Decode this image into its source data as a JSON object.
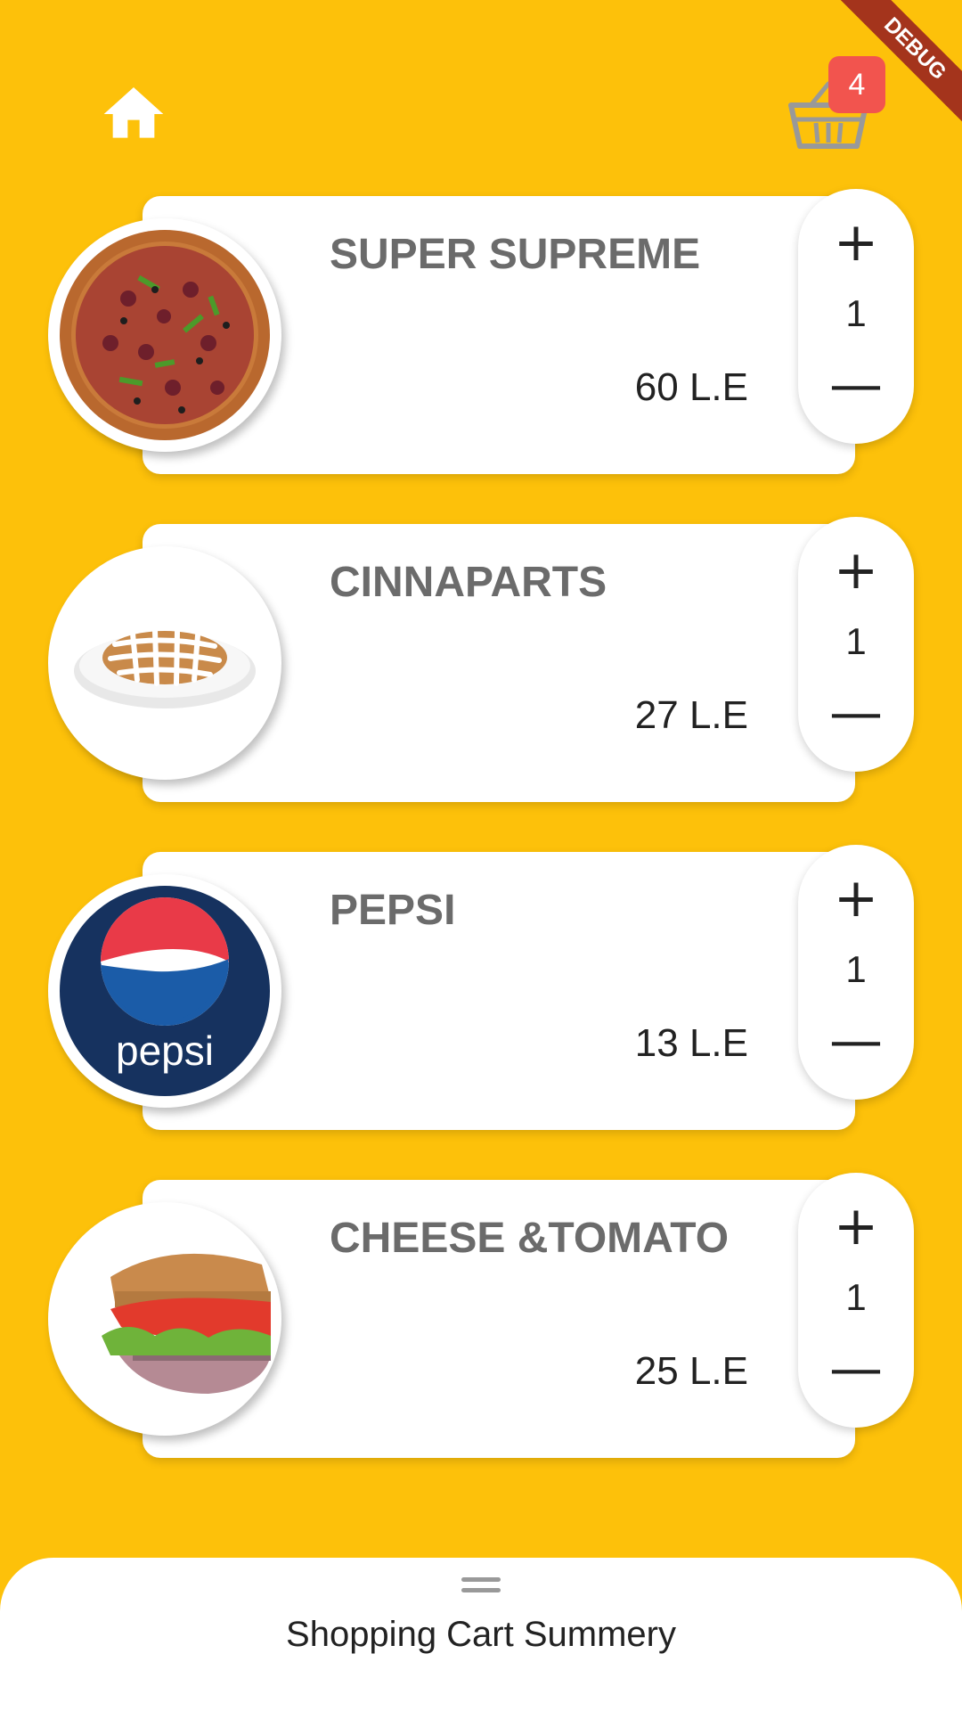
{
  "header": {
    "home_icon": "home-icon",
    "cart_icon": "shopping-basket-icon",
    "cart_count": "4",
    "debug_label": "DEBUG"
  },
  "colors": {
    "background": "#FDC10A",
    "badge": "#F2544E",
    "title_gray": "#6B6B6B",
    "ribbon": "#A4341C"
  },
  "items": [
    {
      "name": "SUPER SUPREME",
      "price": "60 L.E",
      "qty": "1",
      "plus": "+",
      "minus": "—",
      "image": "pizza"
    },
    {
      "name": "CINNAPARTS",
      "price": "27 L.E",
      "qty": "1",
      "plus": "+",
      "minus": "—",
      "image": "cinnaparts"
    },
    {
      "name": "PEPSI",
      "price": "13 L.E",
      "qty": "1",
      "plus": "+",
      "minus": "—",
      "image": "pepsi"
    },
    {
      "name": "CHEESE &TOMATO",
      "price": "25 L.E",
      "qty": "1",
      "plus": "+",
      "minus": "—",
      "image": "sandwich"
    }
  ],
  "pepsi_logo_text": "pepsi",
  "bottom_sheet": {
    "title": "Shopping Cart Summery"
  }
}
